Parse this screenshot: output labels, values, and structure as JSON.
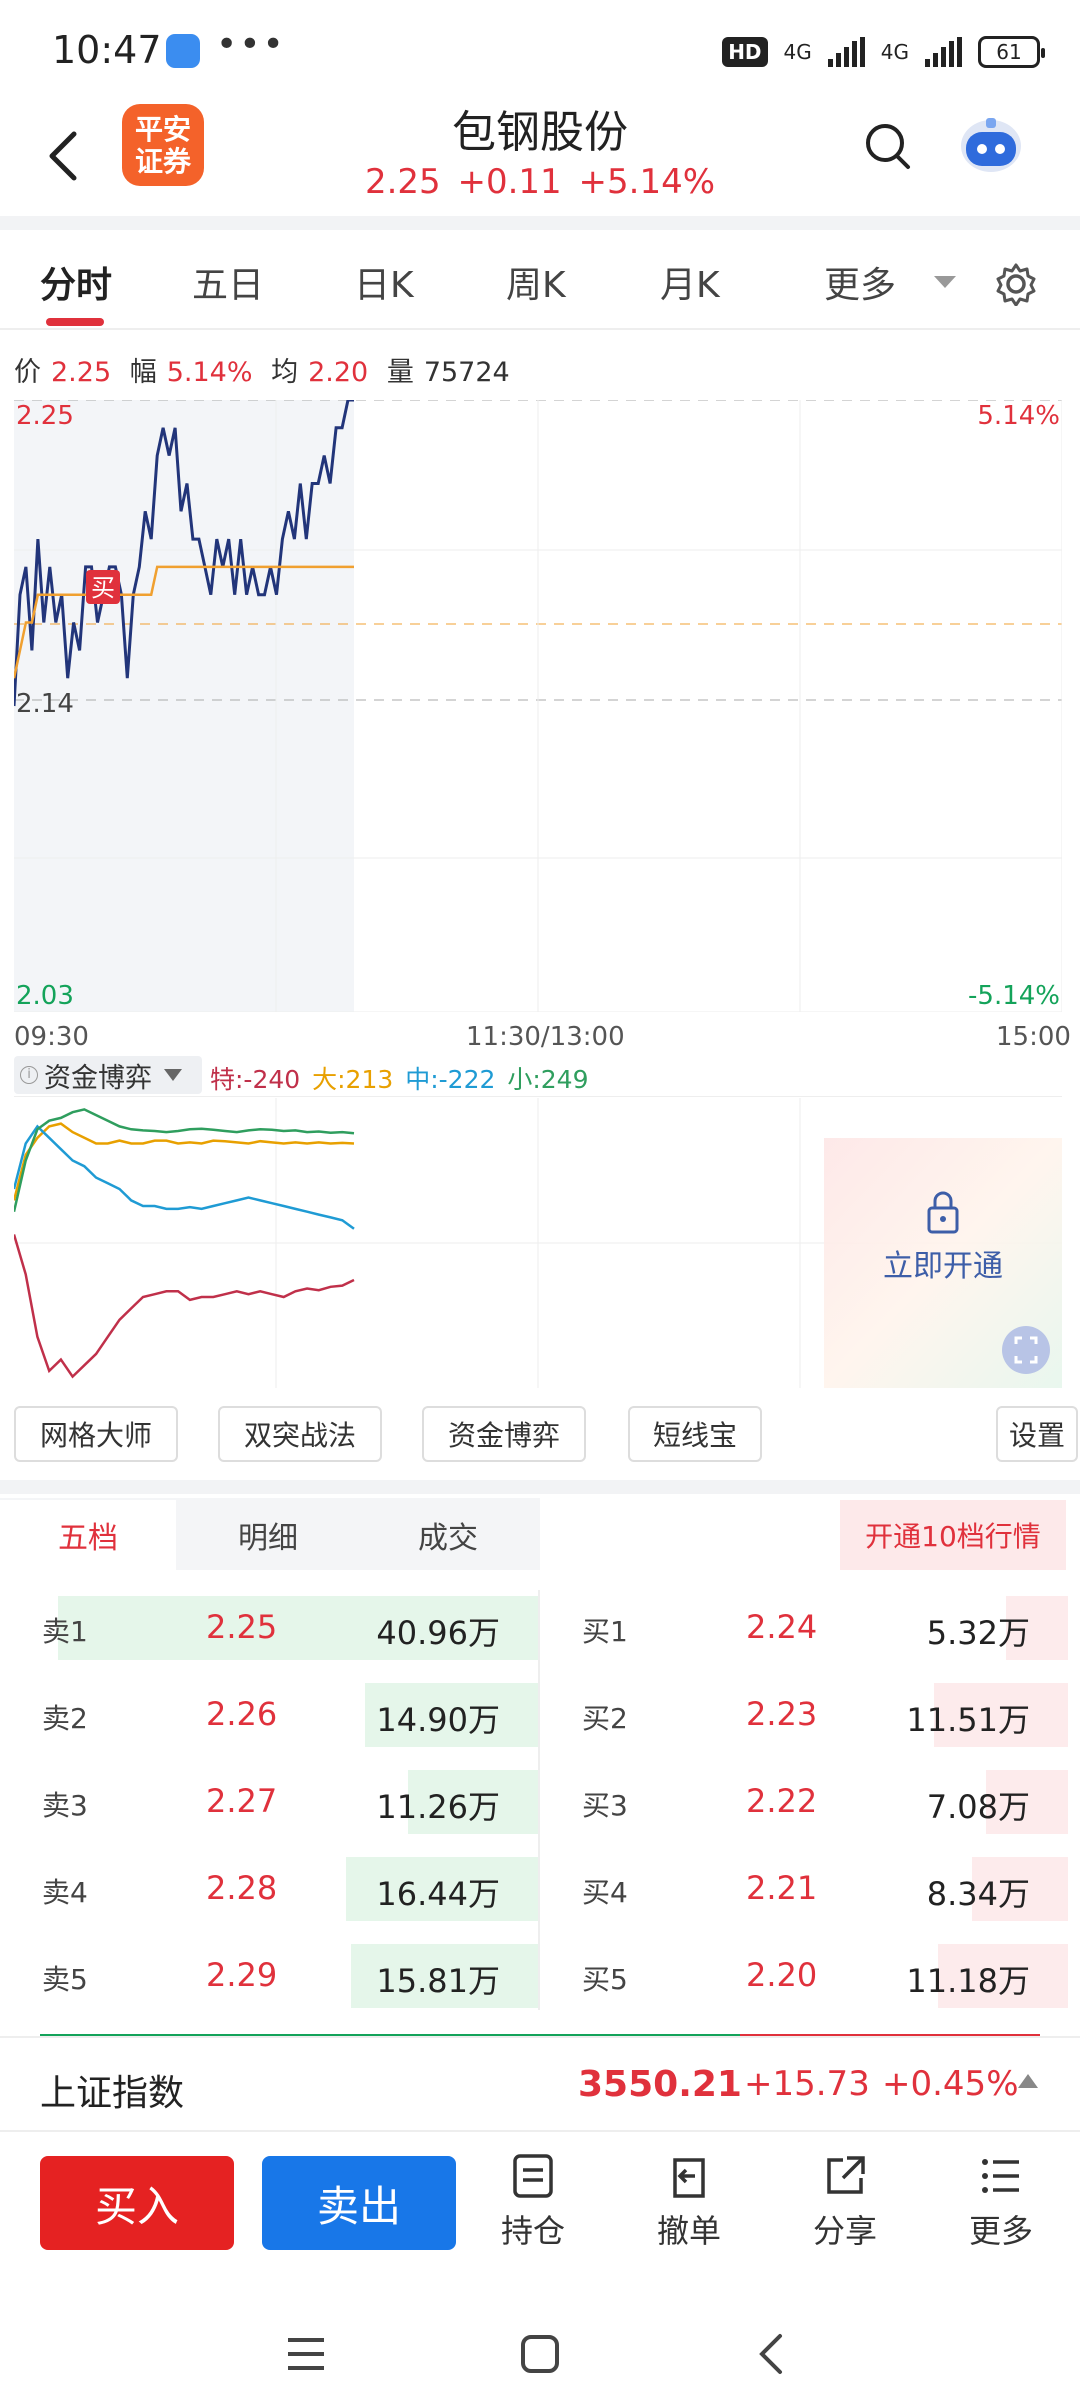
{
  "status": {
    "time": "10:47",
    "dots": "•••",
    "hd_label": "HD",
    "net1": "4G",
    "net2": "4G",
    "battery": "61"
  },
  "header": {
    "logo_text": "平安证券",
    "stock_name": "包钢股份",
    "price": "2.25",
    "change": "+0.11",
    "change_pct": "+5.14%"
  },
  "tabs": [
    "分时",
    "五日",
    "日K",
    "周K",
    "月K",
    "更多"
  ],
  "info": {
    "price_label": "价",
    "price": "2.25",
    "amp_label": "幅",
    "amp": "5.14%",
    "avg_label": "均",
    "avg": "2.20",
    "vol_label": "量",
    "vol": "75724"
  },
  "chart_labels": {
    "y_top": "2.25",
    "y_mid": "2.14",
    "y_bot": "2.03",
    "pct_top": "5.14%",
    "pct_bot": "-5.14%",
    "x_start": "09:30",
    "x_mid": "11:30/13:00",
    "x_end": "15:00",
    "buy_marker": "买"
  },
  "chart_data": {
    "type": "line",
    "x_range": [
      "09:30",
      "15:00"
    ],
    "ylim": [
      2.03,
      2.25
    ],
    "pct_range": [
      "-5.14%",
      "5.14%"
    ],
    "prev_close": 2.14,
    "series": [
      {
        "values": [
          2.14,
          2.18,
          2.19,
          2.16,
          2.2,
          2.17,
          2.19,
          2.17,
          2.18,
          2.15,
          2.17,
          2.16,
          2.19,
          2.19,
          2.17,
          2.18,
          2.19,
          2.19,
          2.18,
          2.15,
          2.18,
          2.19,
          2.21,
          2.2,
          2.23,
          2.24,
          2.23,
          2.24,
          2.21,
          2.22,
          2.2,
          2.2,
          2.19,
          2.18,
          2.2,
          2.19,
          2.2,
          2.18,
          2.2,
          2.18,
          2.19,
          2.18,
          2.18,
          2.19,
          2.18,
          2.2,
          2.21,
          2.2,
          2.22,
          2.2,
          2.22,
          2.22,
          2.23,
          2.22,
          2.24,
          2.24,
          2.25,
          2.25
        ],
        "color": "#22357a"
      },
      {
        "values": [
          2.15,
          2.16,
          2.17,
          2.17,
          2.18,
          2.18,
          2.18,
          2.18,
          2.18,
          2.18,
          2.18,
          2.18,
          2.18,
          2.18,
          2.18,
          2.18,
          2.18,
          2.18,
          2.18,
          2.18,
          2.18,
          2.18,
          2.18,
          2.18,
          2.19,
          2.19,
          2.19,
          2.19,
          2.19,
          2.19,
          2.19,
          2.19,
          2.19,
          2.19,
          2.19,
          2.19,
          2.19,
          2.19,
          2.19,
          2.19,
          2.19,
          2.19,
          2.19,
          2.19,
          2.19,
          2.19,
          2.19,
          2.19,
          2.19,
          2.19,
          2.19,
          2.19,
          2.19,
          2.19,
          2.19,
          2.19,
          2.19,
          2.19
        ],
        "color": "#f0a030"
      }
    ]
  },
  "capital": {
    "tab_label": "资金博弈",
    "legend": [
      {
        "label": "特:-240",
        "color": "#c0304a"
      },
      {
        "label": "大:213",
        "color": "#e8a000"
      },
      {
        "label": "中:-222",
        "color": "#1f9bd4"
      },
      {
        "label": "小:249",
        "color": "#2f9e5e"
      }
    ],
    "unlock_label": "立即开通",
    "chart_data": {
      "type": "line",
      "series": [
        {
          "color": "#c0304a",
          "values": [
            -20,
            -90,
            -200,
            -260,
            -240,
            -270,
            -250,
            -230,
            -200,
            -170,
            -150,
            -130,
            -125,
            -120,
            -120,
            -135,
            -130,
            -130,
            -125,
            -120,
            -125,
            -120,
            -125,
            -130,
            -120,
            -115,
            -118,
            -112,
            -110,
            -100
          ]
        },
        {
          "color": "#e8a000",
          "values": [
            40,
            120,
            150,
            170,
            175,
            160,
            150,
            140,
            140,
            145,
            140,
            140,
            145,
            145,
            140,
            142,
            140,
            145,
            144,
            142,
            140,
            144,
            142,
            140,
            142,
            140,
            142,
            140,
            141,
            140
          ]
        },
        {
          "color": "#1f9bd4",
          "values": [
            60,
            140,
            170,
            150,
            130,
            110,
            100,
            80,
            70,
            60,
            40,
            30,
            30,
            25,
            25,
            28,
            25,
            30,
            35,
            40,
            45,
            40,
            35,
            30,
            25,
            20,
            15,
            10,
            5,
            -10
          ]
        },
        {
          "color": "#2f9e5e",
          "values": [
            20,
            110,
            165,
            180,
            185,
            195,
            200,
            190,
            180,
            170,
            165,
            163,
            162,
            160,
            162,
            165,
            166,
            164,
            162,
            160,
            163,
            165,
            164,
            162,
            163,
            160,
            161,
            159,
            160,
            158
          ]
        }
      ]
    }
  },
  "tools": [
    "网格大师",
    "双突战法",
    "资金博弈",
    "短线宝",
    "设置"
  ],
  "orderbook": {
    "tabs": [
      "五档",
      "明细",
      "成交"
    ],
    "level2_label": "开通10档行情",
    "sell": [
      {
        "label": "卖1",
        "price": "2.25",
        "vol": "40.96万",
        "ratio": 1.0
      },
      {
        "label": "卖2",
        "price": "2.26",
        "vol": "14.90万",
        "ratio": 0.36
      },
      {
        "label": "卖3",
        "price": "2.27",
        "vol": "11.26万",
        "ratio": 0.27
      },
      {
        "label": "卖4",
        "price": "2.28",
        "vol": "16.44万",
        "ratio": 0.4
      },
      {
        "label": "卖5",
        "price": "2.29",
        "vol": "15.81万",
        "ratio": 0.39
      }
    ],
    "buy": [
      {
        "label": "买1",
        "price": "2.24",
        "vol": "5.32万",
        "ratio": 0.13
      },
      {
        "label": "买2",
        "price": "2.23",
        "vol": "11.51万",
        "ratio": 0.28
      },
      {
        "label": "买3",
        "price": "2.22",
        "vol": "7.08万",
        "ratio": 0.17
      },
      {
        "label": "买4",
        "price": "2.21",
        "vol": "8.34万",
        "ratio": 0.2
      },
      {
        "label": "买5",
        "price": "2.20",
        "vol": "11.18万",
        "ratio": 0.27
      }
    ]
  },
  "index": {
    "name": "上证指数",
    "value": "3550.21",
    "change": "+15.73",
    "pct": "+0.45%"
  },
  "actions": {
    "buy": "买入",
    "sell": "卖出",
    "items": [
      "持仓",
      "撤单",
      "分享",
      "更多"
    ]
  }
}
